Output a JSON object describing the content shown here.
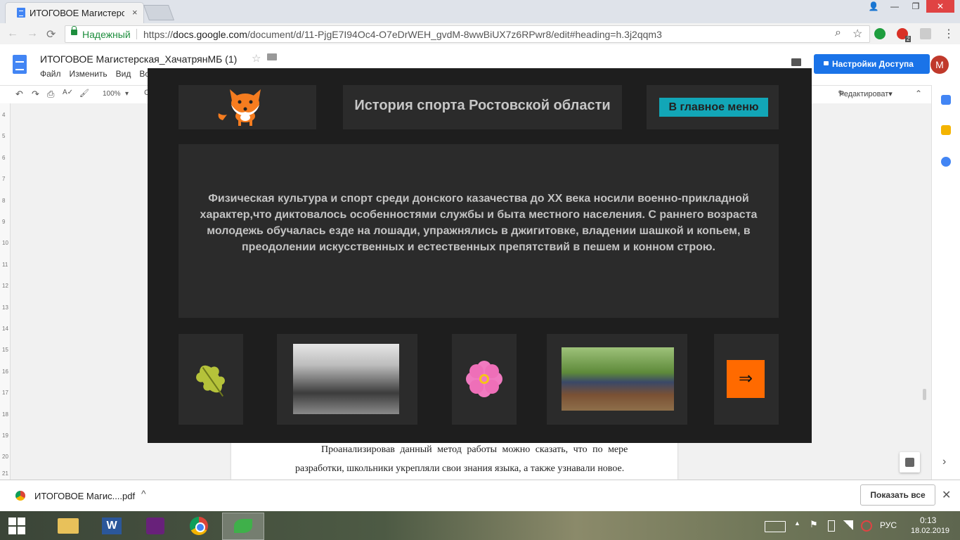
{
  "browser": {
    "tab_title": "ИТОГОВОЕ Магистерска",
    "tab_close": "×",
    "win_controls": [
      "—",
      "❐",
      "✕"
    ],
    "window_user_icon": "user-icon",
    "security_label": "Надежный",
    "url_prefix": "https://",
    "url_domain": "docs.google.com",
    "url_path": "/document/d/11-PjgE7I94Oc4-O7eDrWEH_gvdM-8wwBiUX7z6RPwr8/edit#heading=h.3j2qqm3",
    "back_icon": "←",
    "forward_icon": "→",
    "reload_icon": "⟳",
    "zoom_icon": "⌕",
    "star_icon": "☆",
    "menu_icon": "⋮",
    "ext_badge": "2"
  },
  "docs": {
    "doc_title": "ИТОГОВОЕ Магистерская_ХачатрянМБ (1)",
    "star": "☆",
    "menus": [
      "Файл",
      "Изменить",
      "Вид",
      "Вст"
    ],
    "share_label": "Настройки Доступа",
    "avatar_letter": "M",
    "toolbar": {
      "undo": "↶",
      "redo": "↷",
      "print": "⎙",
      "spell": "A✓",
      "paint": "🖌",
      "zoom": "100%",
      "zoom_arrow": "▾",
      "more": "С"
    },
    "edit_mode": "Редактироват▾",
    "collapse": "⌃",
    "ruler_numbers": [
      "4",
      "5",
      "6",
      "7",
      "8",
      "9",
      "10",
      "11",
      "12",
      "13",
      "14",
      "15",
      "16",
      "17",
      "18",
      "19",
      "20",
      "21"
    ],
    "body_line1": "Проанализировав данный метод работы можно сказать, что по мере",
    "body_line2": "разработки, школьники укрепляли свои знания языка, а также узнавали новое.",
    "side_arrow": "›"
  },
  "app": {
    "title": "История спорта Ростовской области",
    "menu_button": "В главное меню",
    "main_text": "Физическая культура и спорт среди донского казачества до XX века носили военно-прикладной характер,что диктовалось особенностями службы и быта местного населения. С раннего возраста молодежь обучалась езде на лошади, упражнялись в джигитовке, владении шашкой и копьем, в преодолении искусственных и естественных препятствий в пешем и конном строю.",
    "next_arrow": "⇒",
    "colors": {
      "background": "#1e1e1e",
      "panel": "#2b2b2b",
      "accent_button": "#12a6b7",
      "next_button": "#ff6a00",
      "text": "#c3c3c3"
    }
  },
  "downloads": {
    "file_name": "ИТОГОВОЕ Магис....pdf",
    "chevron": "^",
    "show_all": "Показать все",
    "close": "✕"
  },
  "taskbar": {
    "lang": "РУС",
    "time": "0:13",
    "date": "18.02.2019",
    "tray_up": "▲",
    "tray_flag": "⚑"
  }
}
